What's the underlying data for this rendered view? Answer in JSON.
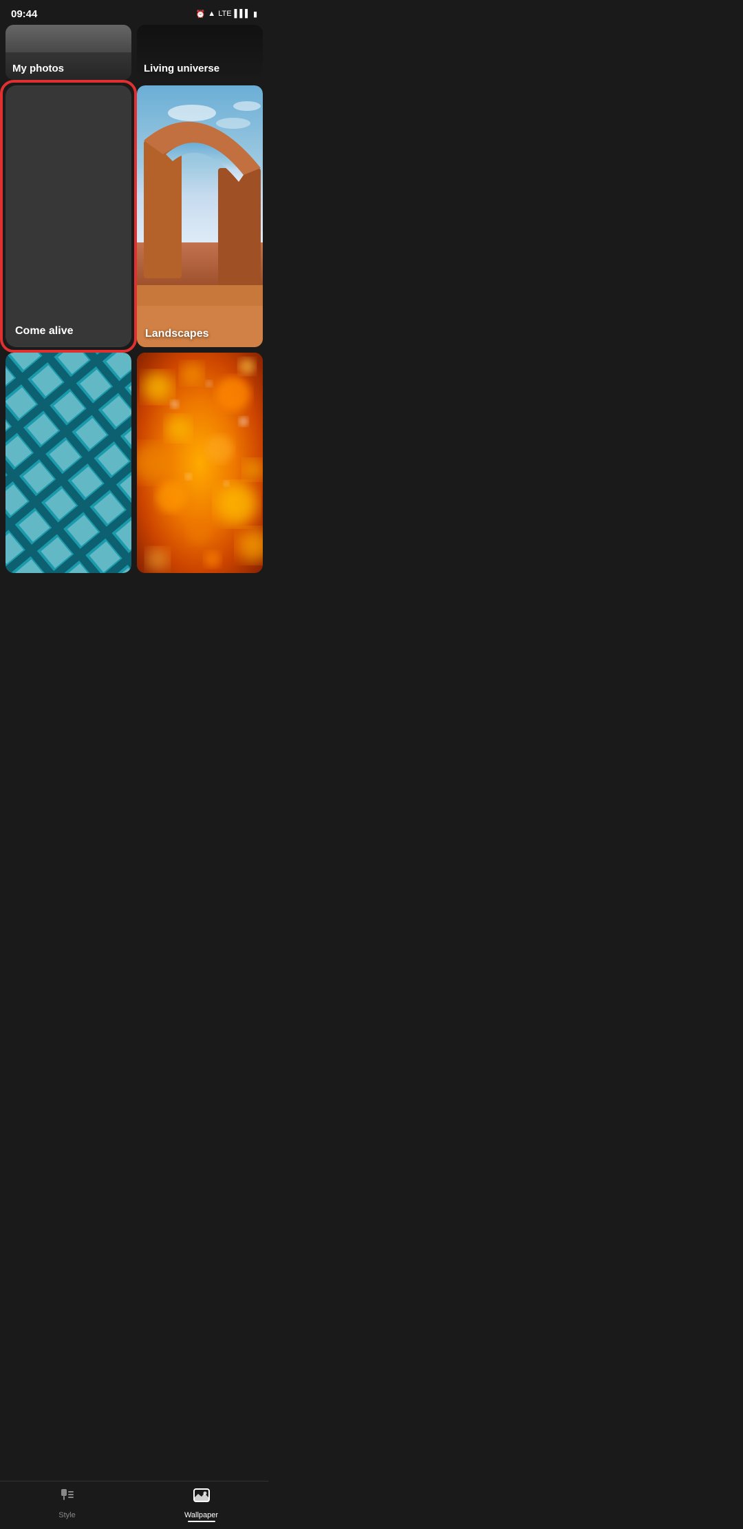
{
  "statusBar": {
    "time": "09:44",
    "alarm": "⏰",
    "signal": "LTE",
    "battery": "🔋"
  },
  "categories": [
    {
      "id": "my-photos",
      "label": "My photos",
      "type": "partial-top",
      "thumbType": "my-photos"
    },
    {
      "id": "living-universe",
      "label": "Living universe",
      "type": "partial-top",
      "thumbType": "living-universe"
    },
    {
      "id": "come-alive",
      "label": "Come alive",
      "type": "main-left",
      "selected": true,
      "thumbType": "come-alive"
    },
    {
      "id": "landscapes",
      "label": "Landscapes",
      "type": "main-right",
      "thumbType": "landscapes"
    },
    {
      "id": "architecture",
      "label": "",
      "type": "bottom-left",
      "thumbType": "architecture"
    },
    {
      "id": "bokeh",
      "label": "",
      "type": "bottom-right",
      "thumbType": "bokeh"
    }
  ],
  "bottomNav": {
    "items": [
      {
        "id": "style",
        "label": "Style",
        "icon": "style"
      },
      {
        "id": "wallpaper",
        "label": "Wallpaper",
        "icon": "wallpaper",
        "active": true
      }
    ]
  }
}
